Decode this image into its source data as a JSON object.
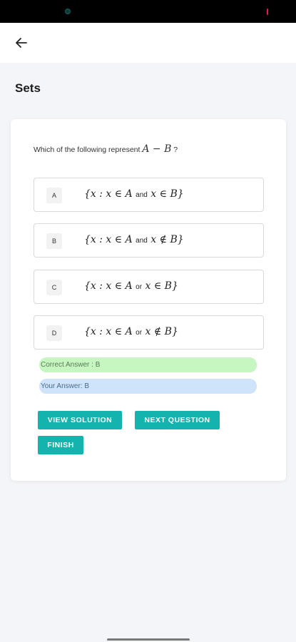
{
  "header": {
    "title": "Sets"
  },
  "question": {
    "prefix": "Which of the following represent",
    "math": "A − B",
    "suffix": "?"
  },
  "options": [
    {
      "letter": "A",
      "lhs": "{x : x ∈ A",
      "connector": "and",
      "rhs": "x ∈ B}"
    },
    {
      "letter": "B",
      "lhs": "{x : x ∈ A",
      "connector": "and",
      "rhs": "x ∉ B}"
    },
    {
      "letter": "C",
      "lhs": "{x : x ∈ A",
      "connector": "or",
      "rhs": "x ∈ B}"
    },
    {
      "letter": "D",
      "lhs": "{x : x ∈ A",
      "connector": "or",
      "rhs": "x ∉ B}"
    }
  ],
  "result": {
    "correct_answer": "Correct Answer : B",
    "your_answer": "Your Answer: B"
  },
  "actions": {
    "view_solution": "VIEW SOLUTION",
    "next_question": "NEXT QUESTION",
    "finish": "FINISH"
  },
  "colors": {
    "accent": "#15b3ad",
    "correct_bg": "#c7f7c1",
    "your_bg": "#cfe4fb"
  },
  "icons": {
    "back": "arrow-left-icon"
  }
}
